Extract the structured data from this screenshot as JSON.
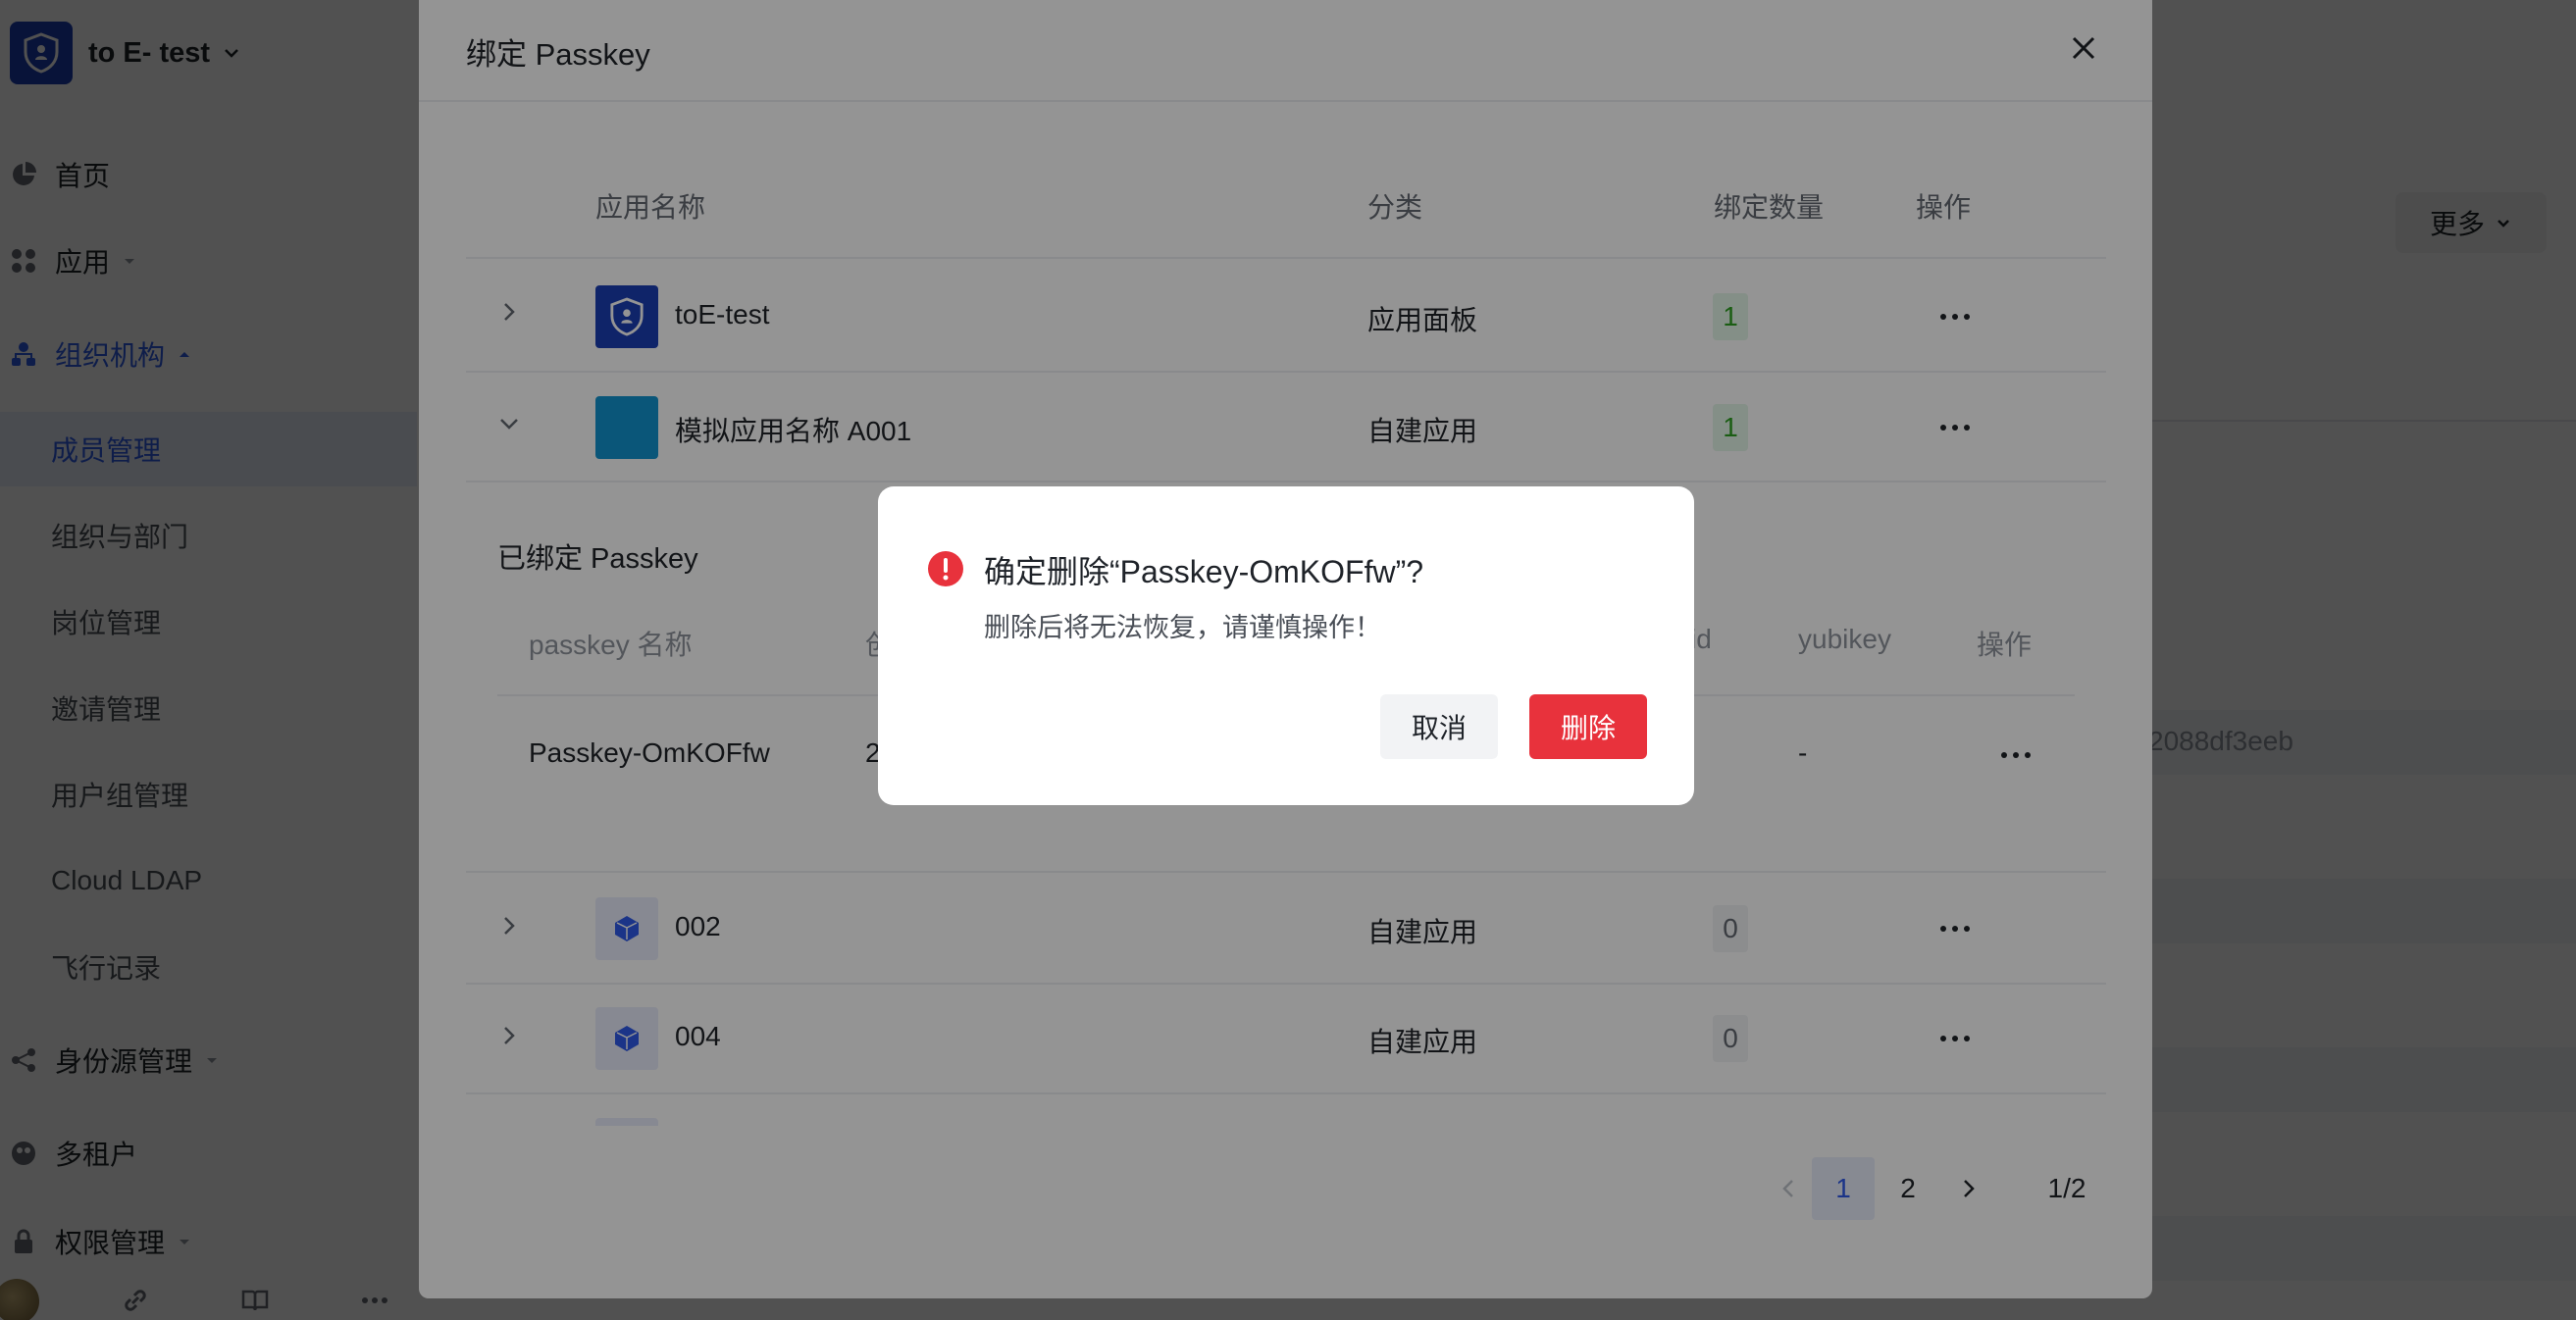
{
  "sidebar": {
    "brand": "to E- test",
    "nav": {
      "home": "首页",
      "apps": "应用",
      "org": "组织机构",
      "identity": "身份源管理",
      "tenant": "多租户",
      "perm": "权限管理"
    },
    "sub_items": [
      "成员管理",
      "组织与部门",
      "岗位管理",
      "邀请管理",
      "用户组管理",
      "Cloud LDAP",
      "飞行记录"
    ]
  },
  "background": {
    "more_label": "更多",
    "hash_text": "2088df3eeb"
  },
  "drawer": {
    "title": "绑定 Passkey",
    "columns": {
      "name": "应用名称",
      "category": "分类",
      "count": "绑定数量",
      "actions": "操作"
    },
    "rows": [
      {
        "name": "toE-test",
        "category": "应用面板",
        "count": "1"
      },
      {
        "name": "模拟应用名称 A001",
        "category": "自建应用",
        "count": "1"
      },
      {
        "name": "002",
        "category": "自建应用",
        "count": "0"
      },
      {
        "name": "004",
        "category": "自建应用",
        "count": "0"
      }
    ],
    "sub_panel": {
      "title": "已绑定 Passkey",
      "columns": {
        "name": "passkey 名称",
        "created_partial": "创",
        "id_partial": "id",
        "yubikey": "yubikey",
        "actions": "操作"
      },
      "row": {
        "name": "Passkey-OmKOFfw",
        "created_partial": "2",
        "yubikey": "-"
      }
    },
    "pagination": {
      "pages": [
        "1",
        "2"
      ],
      "current": "1",
      "summary": "1/2"
    }
  },
  "confirm": {
    "title": "确定删除“Passkey-OmKOFfw”?",
    "description": "删除后将无法恢复，请谨慎操作！",
    "cancel_label": "取消",
    "delete_label": "删除"
  },
  "colors": {
    "primary": "#2f5bea",
    "danger": "#e8323c",
    "brand": "#1b3eb5",
    "success": "#2ea121"
  }
}
